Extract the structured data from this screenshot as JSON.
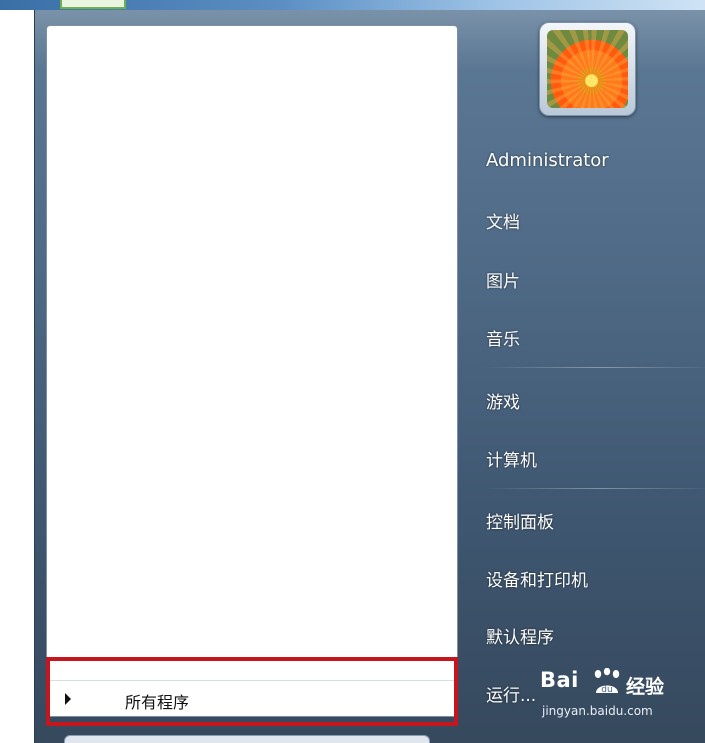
{
  "start_menu": {
    "all_programs_label": "所有程序",
    "user_name": "Administrator",
    "right_items": [
      "文档",
      "图片",
      "音乐",
      "游戏",
      "计算机",
      "控制面板",
      "设备和打印机",
      "默认程序",
      "运行..."
    ],
    "highlight_color": "#c4161c"
  },
  "watermark": {
    "brand": "Bai",
    "cn": "经验",
    "url": "jingyan.baidu.com"
  }
}
